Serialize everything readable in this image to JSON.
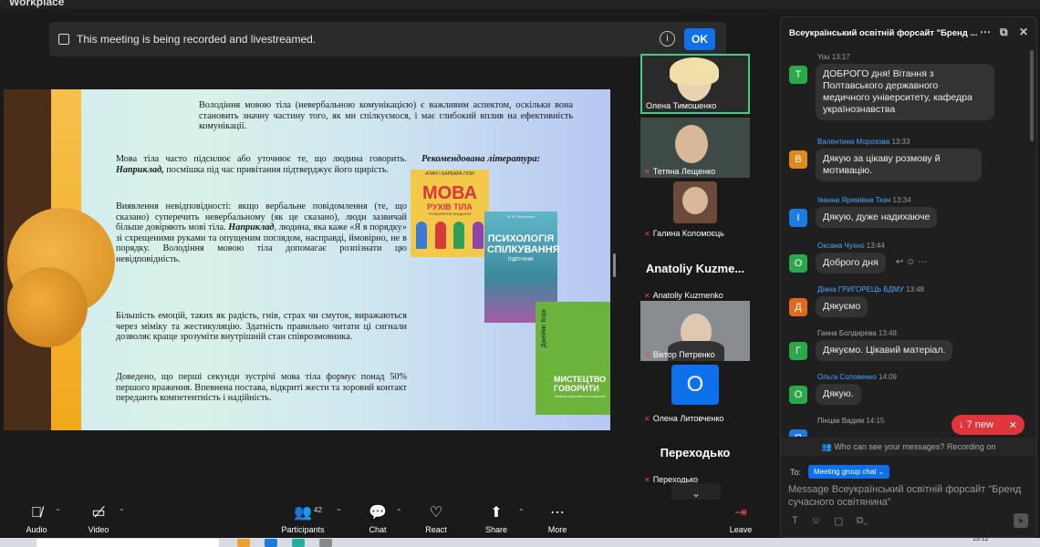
{
  "app": {
    "brand": "Workplace"
  },
  "banner": {
    "text": "This meeting is being recorded and livestreamed.",
    "info_icon": "info-icon",
    "ok_label": "OK"
  },
  "slide": {
    "p0": "Володіння мовою тіла (невербальною комунікацією) є важливим аспектом, оскільки вона становить значну частину того, як ми спілкуємося, і має глибокий вплив на ефективність комунікації.",
    "p1a": "Мова тіла часто підсилює або уточнює те, що людина говорить.",
    "p1b": "Наприклад,",
    "p1c": "посмішка під час привітання підтверджує його щирість.",
    "p2a": "Виявлення невідповідності: якщо вербальне повідомлення (те, що сказано) суперечить невербальному (як це сказано), люди зазвичай більше довіряють мові тіла.",
    "p2b": "Наприклад",
    "p2c": ", людина, яка каже «Я в порядку» зі схрещеними руками та опущеним поглядом, насправді, ймовірно, не в порядку. Володіння мовою тіла допомагає розпізнати цю невідповідність.",
    "p3": "Більшість емоцій, таких як радість, гнів, страх чи смуток, виражаються через міміку та жестикуляцію. Здатність правильно читати ці сигнали дозволяє краще зрозуміти внутрішній стан співрозмовника.",
    "p4": "Доведено, що перші секунди зустрічі мова тіла формує понад 50% першого враження. Впевнена постава, відкриті жести та зоровий контакт передають компетентність і надійність.",
    "rec_title": "Рекомендована література:",
    "book1": {
      "author": "АЛАН І БАРБАРА ПІЗИ",
      "title1": "МОВА",
      "title2": "РУХІВ ТІЛА",
      "sub": "РОЗШИРЕНЕ ВИДАННЯ"
    },
    "book2": {
      "author": "М. М. Філоненко",
      "title": "ПСИХОЛОГІЯ СПІЛКУВАННЯ",
      "sub": "ПІДРУЧНИК"
    },
    "book3": {
      "author": "Джеймс Борг",
      "title": "МИСТЕЦТВО ГОВОРИТИ",
      "sub": "Таємниці ефективного спілкування"
    }
  },
  "participants": [
    {
      "name": "Олена Тимошенко",
      "muted": false
    },
    {
      "name": "Тетяна Лещенко",
      "muted": true
    },
    {
      "name": "Галина Коломоєць",
      "muted": true
    },
    {
      "display": "Anatoliy  Kuzme...",
      "name": "Anatoliy Kuzmenko",
      "muted": true
    },
    {
      "name": "Віктор Петренко",
      "muted": true
    },
    {
      "avatar": "O",
      "name": "Олена Литовченко",
      "muted": true
    },
    {
      "display": "Переходько",
      "name": "Переходько",
      "muted": true
    }
  ],
  "chat": {
    "title": "Всеукраїнський освітній форсайт \"Бренд ...",
    "messages": [
      {
        "sender": "You",
        "time": "13:17",
        "avatar": "T",
        "color": "#2aa84a",
        "text": "ДОБРОГО дня! Вітання з Полтавського державного медичного університету, кафедра українознавства"
      },
      {
        "sender": "Валентина Морозова",
        "time": "13:33",
        "avatar": "В",
        "color": "#e08a1c",
        "text": "Дякую за цікаву розмову й мотивацію."
      },
      {
        "sender": "Іванна Яремівна Ткач",
        "time": "13:34",
        "avatar": "І",
        "color": "#1c7be0",
        "text": "Дякую, дуже надихаюче"
      },
      {
        "sender": "Оксана Чухно",
        "time": "13:44",
        "avatar": "О",
        "color": "#2aa84a",
        "text": "Доброго дня"
      },
      {
        "sender": "Діана ГРИГОРЕЦЬ БДМУ",
        "time": "13:48",
        "avatar": "Д",
        "color": "#e06a1c",
        "text": "Дякуємо"
      },
      {
        "sender": "Ганна Болдирева",
        "time": "13:48",
        "avatar": "Г",
        "color": "#2aa84a",
        "text": "Дякуємо. Цікавий матеріал."
      },
      {
        "sender": "Ольга Соловенко",
        "time": "14:09",
        "avatar": "О",
        "color": "#2aa84a",
        "text": "Дякую."
      },
      {
        "sender": "Пінцак Вадим",
        "time": "14:15",
        "avatar": "П",
        "color": "#1c7be0",
        "text": ""
      }
    ],
    "new_count": "7 new",
    "who_can_see": "Who can see your messages? Recording on",
    "to_label": "To:",
    "to_value": "Meeting group chat",
    "compose_placeholder": "Message Всеукраїнський освітній форсайт \"Бренд сучасного освітянина\""
  },
  "toolbar": {
    "audio": "Audio",
    "video": "Video",
    "participants": "Participants",
    "participants_count": "42",
    "chat": "Chat",
    "react": "React",
    "share": "Share",
    "more": "More",
    "leave": "Leave"
  },
  "taskbar": {
    "time": "15:12"
  }
}
